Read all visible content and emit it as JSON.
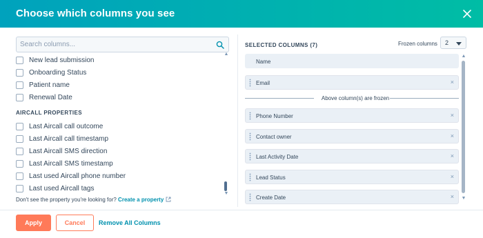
{
  "dialog": {
    "title": "Choose which columns you see",
    "close_icon": "close-icon"
  },
  "left": {
    "search": {
      "placeholder": "Search columns...",
      "value": "",
      "icon": "search-icon"
    },
    "items_top": [
      {
        "label": "New lead submission",
        "checked": false
      },
      {
        "label": "Onboarding Status",
        "checked": false
      },
      {
        "label": "Patient name",
        "checked": false
      },
      {
        "label": "Renewal Date",
        "checked": false
      }
    ],
    "section_heading": "AIRCALL PROPERTIES",
    "items_aircall": [
      {
        "label": "Last Aircall call outcome",
        "checked": false
      },
      {
        "label": "Last Aircall call timestamp",
        "checked": false
      },
      {
        "label": "Last Aircall SMS direction",
        "checked": false
      },
      {
        "label": "Last Aircall SMS timestamp",
        "checked": false
      },
      {
        "label": "Last used Aircall phone number",
        "checked": false
      },
      {
        "label": "Last used Aircall tags",
        "checked": false
      }
    ],
    "help_text": "Don't see the property you're looking for?",
    "help_link": "Create a property"
  },
  "right": {
    "title": "SELECTED COLUMNS (7)",
    "frozen_label": "Frozen columns",
    "frozen_value": "2",
    "frozen_separator": "Above column(s) are frozen",
    "remove_icon": "×",
    "columns_frozen": [
      {
        "label": "Name",
        "removable": false,
        "draggable": false
      },
      {
        "label": "Email",
        "removable": true,
        "draggable": true
      }
    ],
    "columns": [
      {
        "label": "Phone Number"
      },
      {
        "label": "Contact owner"
      },
      {
        "label": "Last Activity Date"
      },
      {
        "label": "Lead Status"
      },
      {
        "label": "Create Date"
      }
    ]
  },
  "footer": {
    "apply_label": "Apply",
    "cancel_label": "Cancel",
    "remove_all_label": "Remove All Columns"
  },
  "colors": {
    "header_start": "#00a2bd",
    "header_end": "#00bda5",
    "primary_button": "#ff7a59",
    "link": "#0091ae"
  }
}
